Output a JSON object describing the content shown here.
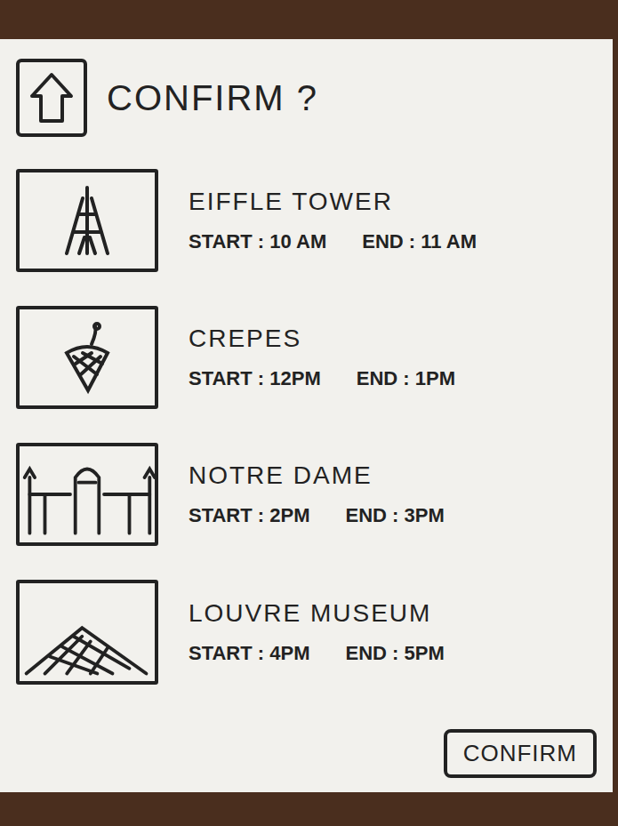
{
  "header": {
    "title": "CONFIRM ?"
  },
  "items": [
    {
      "name": "EIFFLE TOWER",
      "start": "START : 10 AM",
      "end": "END : 11 AM"
    },
    {
      "name": "CREPES",
      "start": "START : 12PM",
      "end": "END : 1PM"
    },
    {
      "name": "NOTRE DAME",
      "start": "START : 2PM",
      "end": "END : 3PM"
    },
    {
      "name": "LOUVRE MUSEUM",
      "start": "START : 4PM",
      "end": "END : 5PM"
    }
  ],
  "buttons": [
    "CONFIRM"
  ]
}
